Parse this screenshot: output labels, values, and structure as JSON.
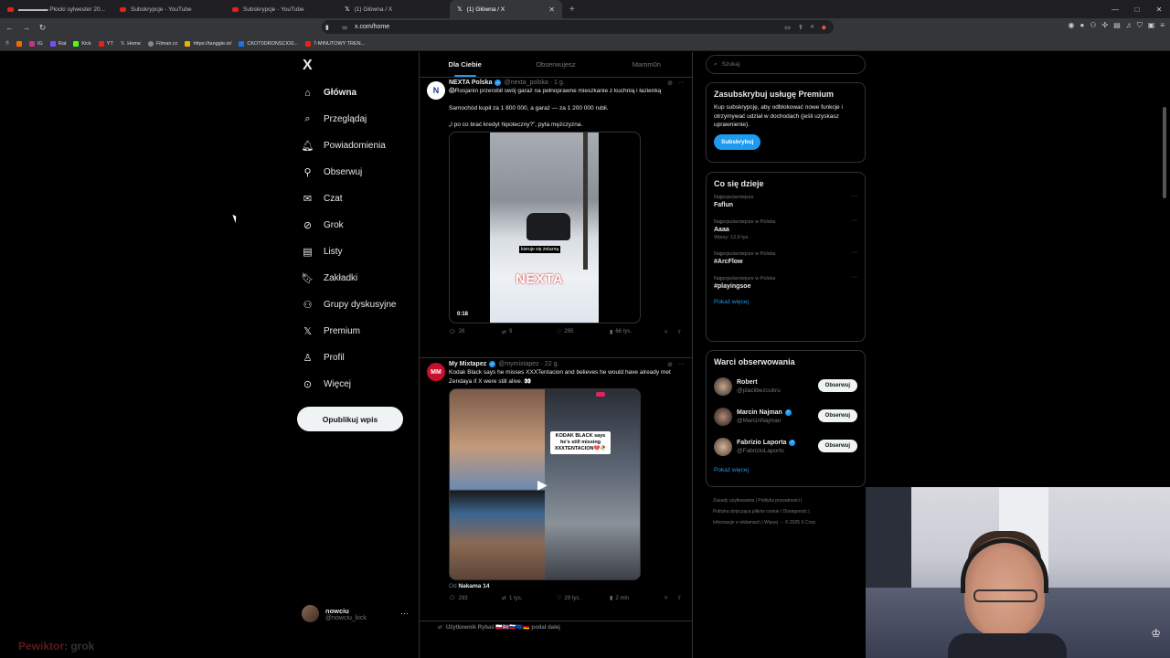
{
  "browser": {
    "tabs": [
      {
        "title": "▬▬▬▬▬ Płocki sylwester 20...",
        "icon": "youtube-icon",
        "active": false
      },
      {
        "title": "Subskrypcje - YouTube",
        "icon": "youtube-icon",
        "active": false
      },
      {
        "title": "Subskrypcje - YouTube",
        "icon": "youtube-icon",
        "active": false
      },
      {
        "title": "(1) Główna / X",
        "icon": "x-icon",
        "active": false
      },
      {
        "title": "(1) Główna / X",
        "icon": "x-icon",
        "active": true
      }
    ],
    "url": "x.com/home",
    "bookmarks": [
      "IG",
      "Rat",
      "Kick",
      "YT",
      "Home",
      "Filman.cc",
      "https://tanggle.io/",
      "CKOT0DRONSCIO0...",
      "7-MINUTOWY TREN..."
    ]
  },
  "nav": {
    "logo": "X",
    "items": [
      {
        "label": "Główna",
        "icon": "home-icon"
      },
      {
        "label": "Przeglądaj",
        "icon": "search-icon"
      },
      {
        "label": "Powiadomienia",
        "icon": "bell-icon"
      },
      {
        "label": "Obserwuj",
        "icon": "follow-icon"
      },
      {
        "label": "Czat",
        "icon": "mail-icon"
      },
      {
        "label": "Grok",
        "icon": "grok-icon"
      },
      {
        "label": "Listy",
        "icon": "list-icon"
      },
      {
        "label": "Zakładki",
        "icon": "bookmark-icon"
      },
      {
        "label": "Grupy dyskusyjne",
        "icon": "communities-icon"
      },
      {
        "label": "Premium",
        "icon": "x-icon"
      },
      {
        "label": "Profil",
        "icon": "profile-icon"
      },
      {
        "label": "Więcej",
        "icon": "more-icon"
      }
    ],
    "post_button": "Opublikuj wpis",
    "profile": {
      "name": "nowciu",
      "handle": "@nowciu_kick",
      "more": "···"
    }
  },
  "timeline": {
    "tabs": [
      "Dla Ciebie",
      "Obserwujesz",
      "Mamm0n"
    ],
    "tweets": [
      {
        "name": "NEXTA Polska",
        "handle": "@nexta_polska · 1 g.",
        "avatar_text": "N",
        "lines": [
          "😱Rosjanin przerobił swój garaż na pełnoprawne mieszkanie z kuchnią i łazienką",
          "Samochód kupił za 1 800 000, a garaż — za 1 200 000 rubli.",
          "„I po co brać kredyt hipoteczny?”, pyta mężczyzna."
        ],
        "video_caption": "kieruje się żelazną",
        "video_brand": "NEXTA",
        "duration": "0:18",
        "replies": "26",
        "reposts": "9",
        "likes": "295",
        "views": "66 tys."
      },
      {
        "name": "My Mixtapez",
        "handle": "@mymixtapez · 22 g.",
        "avatar_text": "MM",
        "text": "Kodak Black says he misses XXXTentacion and believes he would have already met Zendaya if X were still alive. 👀",
        "bubble": "KODAK BLACK says he's still missing XXXTENTACION💔🥀",
        "from_prefix": "Od",
        "from_name": "Nakama 14",
        "replies": "293",
        "reposts": "1 tys.",
        "likes": "29 tys.",
        "views": "2 mln"
      }
    ],
    "retweet_bar": "Użytkownik Rybaś 🇵🇱🇬🇧🇷🇺🇪🇺🇩🇪 podał dalej"
  },
  "right": {
    "search_placeholder": "Szukaj",
    "premium": {
      "title": "Zasubskrybuj usługę Premium",
      "text": "Kup subskrypcję, aby odblokować nowe funkcje i otrzymywać udział w dochodach (jeśli uzyskasz uprawnienie).",
      "button": "Subskrybuj"
    },
    "trends": {
      "title": "Co się dzieje",
      "items": [
        {
          "context": "Najpopularniejsze",
          "name": "Faflun",
          "posts": ""
        },
        {
          "context": "Najpopularniejsze w Polska",
          "name": "Aaaa",
          "posts": "Wpisy: 12,9 tys."
        },
        {
          "context": "Najpopularniejsze w Polska",
          "name": "#ArcFlow",
          "posts": ""
        },
        {
          "context": "Najpopularniejsze w Polska",
          "name": "#playingsoe",
          "posts": ""
        }
      ],
      "show_more": "Pokaż więcej"
    },
    "follow": {
      "title": "Warci obserwowania",
      "items": [
        {
          "name": "Robert",
          "handle": "@placlibezcukru",
          "verified": false,
          "button": "Obserwuj"
        },
        {
          "name": "Marcin Najman",
          "handle": "@MarcinNajman",
          "verified": true,
          "button": "Obserwuj"
        },
        {
          "name": "Fabrizio Laporta",
          "handle": "@FabrizioLaporto",
          "verified": true,
          "button": "Obserwuj"
        }
      ],
      "show_more": "Pokaż więcej"
    },
    "footer": [
      "Zasady użytkowania",
      "Polityka prywatności",
      "Polityka dotycząca plików cookie",
      "Dostępność",
      "Informacje o reklamach",
      "Więcej ···",
      "© 2025 X Corp."
    ]
  },
  "overlay": {
    "chat_nick": "Pewiktor",
    "chat_msg": ": grok"
  }
}
